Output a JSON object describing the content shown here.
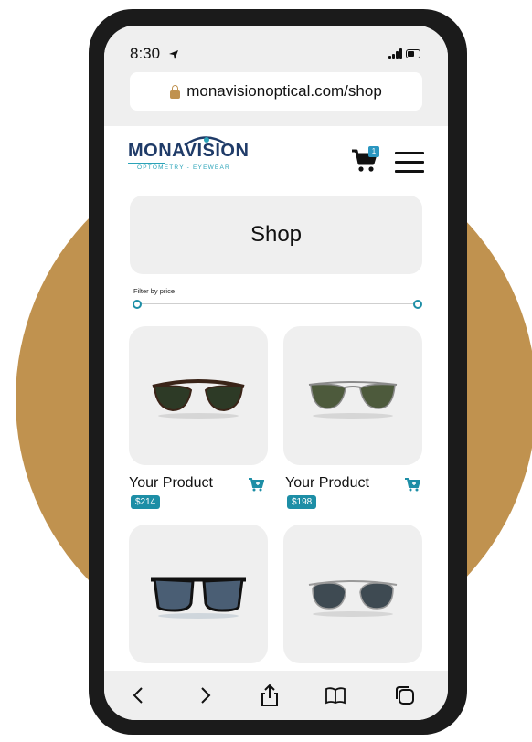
{
  "status_bar": {
    "time": "8:30"
  },
  "browser": {
    "url": "monavisionoptical.com/shop"
  },
  "header": {
    "logo_primary": "MONA",
    "logo_secondary": "VISION",
    "logo_tagline": "OPTOMETRY - EYEWEAR",
    "cart_count": "1"
  },
  "shop": {
    "title": "Shop",
    "filter_label": "Filter by price"
  },
  "products": [
    {
      "name": "Your Product",
      "price": "$214"
    },
    {
      "name": "Your Product",
      "price": "$198"
    },
    {
      "name": "",
      "price": ""
    },
    {
      "name": "",
      "price": ""
    }
  ],
  "colors": {
    "accent": "#1d8ea6",
    "background_circle": "#c0924f",
    "brand_navy": "#1f3b68"
  },
  "icons": [
    "location-arrow-icon",
    "signal-icon",
    "battery-icon",
    "lock-icon",
    "cart-icon",
    "menu-icon",
    "add-to-cart-icon",
    "back-icon",
    "forward-icon",
    "share-icon",
    "bookmarks-icon",
    "tabs-icon"
  ]
}
